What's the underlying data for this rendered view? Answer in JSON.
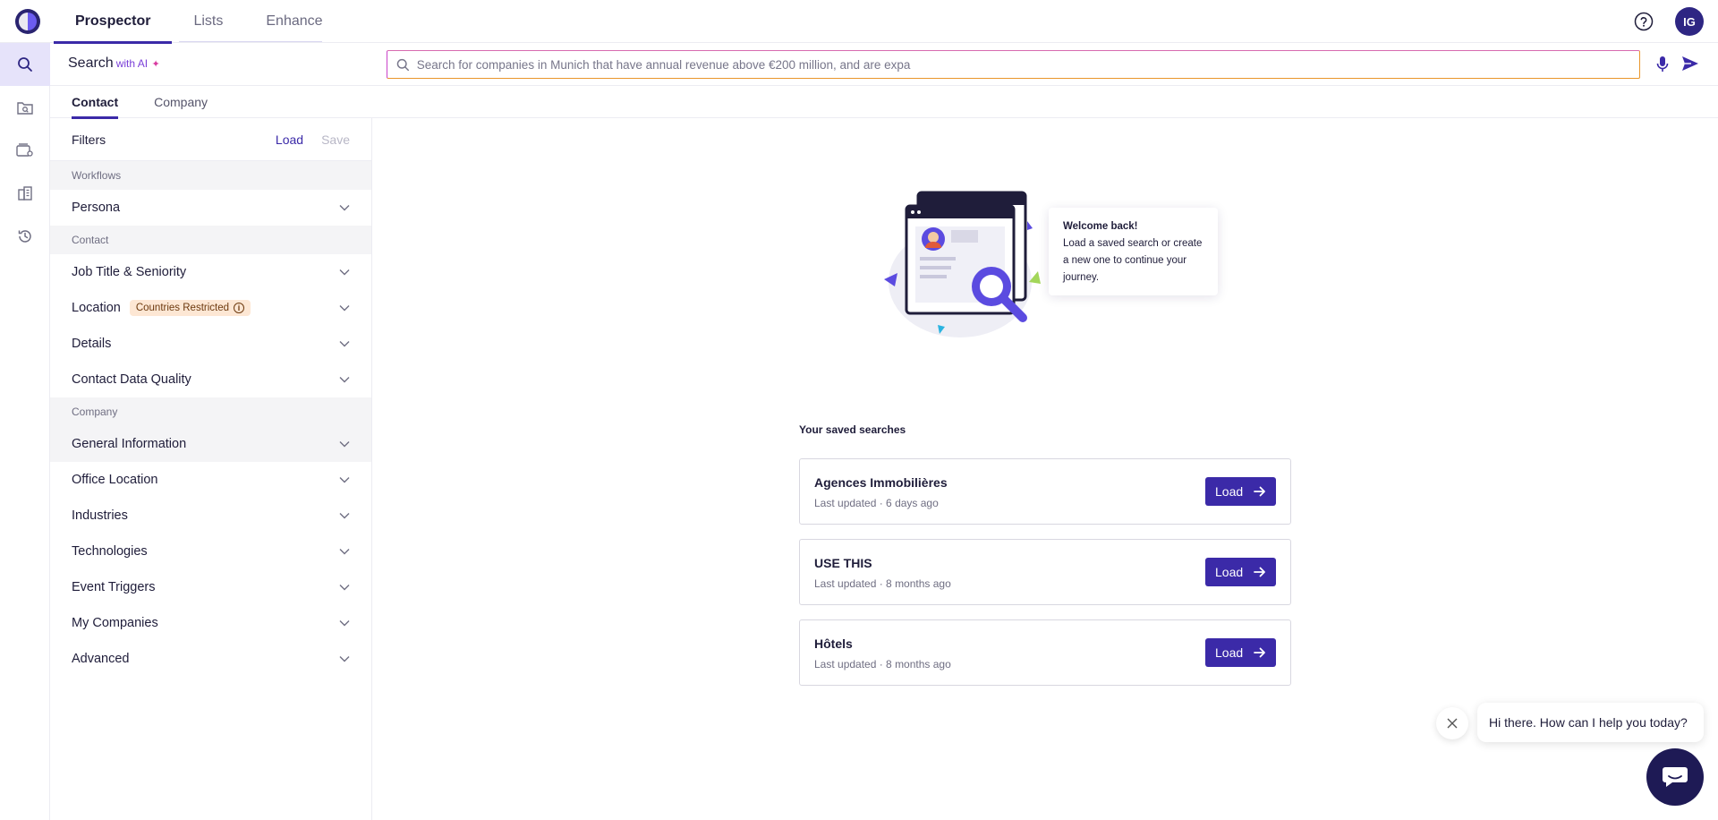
{
  "nav": {
    "items": [
      {
        "label": "Prospector",
        "active": true
      },
      {
        "label": "Lists",
        "active": false
      },
      {
        "label": "Enhance",
        "active": false
      }
    ],
    "avatar_initials": "IG"
  },
  "search": {
    "label": "Search",
    "ai_label": "with AI",
    "placeholder": "Search for companies in Munich that have annual revenue above €200 million, and are expa"
  },
  "tabs": [
    {
      "label": "Contact",
      "active": true
    },
    {
      "label": "Company",
      "active": false
    }
  ],
  "filters": {
    "title": "Filters",
    "load_label": "Load",
    "save_label": "Save",
    "sections": [
      {
        "title": "Workflows",
        "items": [
          {
            "label": "Persona"
          }
        ]
      },
      {
        "title": "Contact",
        "items": [
          {
            "label": "Job Title & Seniority"
          },
          {
            "label": "Location",
            "badge": "Countries Restricted"
          },
          {
            "label": "Details"
          },
          {
            "label": "Contact Data Quality"
          }
        ]
      },
      {
        "title": "Company",
        "items": [
          {
            "label": "General Information"
          },
          {
            "label": "Office Location"
          },
          {
            "label": "Industries"
          },
          {
            "label": "Technologies"
          },
          {
            "label": "Event Triggers"
          },
          {
            "label": "My Companies"
          },
          {
            "label": "Advanced"
          }
        ]
      }
    ]
  },
  "welcome": {
    "title": "Welcome back!",
    "body": "Load a saved search or create a new one to continue your journey."
  },
  "saved": {
    "title": "Your saved searches",
    "items": [
      {
        "name": "Agences Immobilières",
        "meta": "Last updated · 6 days ago",
        "button": "Load"
      },
      {
        "name": "USE THIS",
        "meta": "Last updated · 8 months ago",
        "button": "Load"
      },
      {
        "name": "Hôtels",
        "meta": "Last updated · 8 months ago",
        "button": "Load"
      }
    ]
  },
  "chat": {
    "greeting": "Hi there. How can I help you today?"
  },
  "colors": {
    "accent": "#3b2aa8",
    "badge_bg": "#fde7d4",
    "chat_launcher": "#1e1a55"
  }
}
